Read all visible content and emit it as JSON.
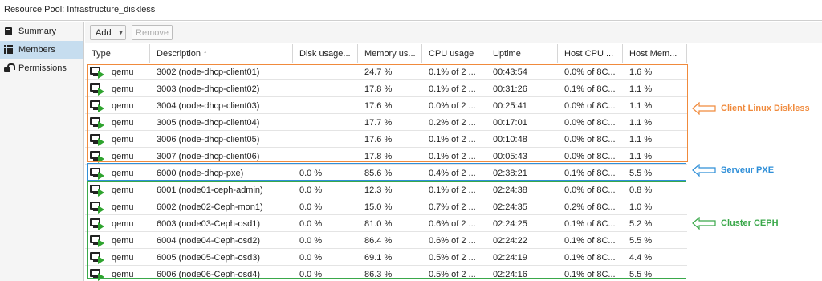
{
  "title": "Resource Pool: Infrastructure_diskless",
  "sidebar": {
    "items": [
      {
        "label": "Summary",
        "icon": "book-icon"
      },
      {
        "label": "Members",
        "icon": "grid-icon",
        "active": true
      },
      {
        "label": "Permissions",
        "icon": "unlock-icon"
      }
    ]
  },
  "toolbar": {
    "add_label": "Add",
    "remove_label": "Remove"
  },
  "table": {
    "columns": [
      "Type",
      "Description",
      "Disk usage...",
      "Memory us...",
      "CPU usage",
      "Uptime",
      "Host CPU ...",
      "Host Mem..."
    ],
    "sort_indicator": "↑",
    "rows": [
      {
        "type": "qemu",
        "description": "3002 (node-dhcp-client01)",
        "disk": "",
        "memory": "24.7 %",
        "cpu": "0.1% of 2 ...",
        "uptime": "00:43:54",
        "host_cpu": "0.0% of 8C...",
        "host_mem": "1.6 %"
      },
      {
        "type": "qemu",
        "description": "3003 (node-dhcp-client02)",
        "disk": "",
        "memory": "17.8 %",
        "cpu": "0.1% of 2 ...",
        "uptime": "00:31:26",
        "host_cpu": "0.1% of 8C...",
        "host_mem": "1.1 %"
      },
      {
        "type": "qemu",
        "description": "3004 (node-dhcp-client03)",
        "disk": "",
        "memory": "17.6 %",
        "cpu": "0.0% of 2 ...",
        "uptime": "00:25:41",
        "host_cpu": "0.0% of 8C...",
        "host_mem": "1.1 %"
      },
      {
        "type": "qemu",
        "description": "3005 (node-dhcp-client04)",
        "disk": "",
        "memory": "17.7 %",
        "cpu": "0.2% of 2 ...",
        "uptime": "00:17:01",
        "host_cpu": "0.0% of 8C...",
        "host_mem": "1.1 %"
      },
      {
        "type": "qemu",
        "description": "3006 (node-dhcp-client05)",
        "disk": "",
        "memory": "17.6 %",
        "cpu": "0.1% of 2 ...",
        "uptime": "00:10:48",
        "host_cpu": "0.0% of 8C...",
        "host_mem": "1.1 %"
      },
      {
        "type": "qemu",
        "description": "3007 (node-dhcp-client06)",
        "disk": "",
        "memory": "17.8 %",
        "cpu": "0.1% of 2 ...",
        "uptime": "00:05:43",
        "host_cpu": "0.0% of 8C...",
        "host_mem": "1.1 %"
      },
      {
        "type": "qemu",
        "description": "6000 (node-dhcp-pxe)",
        "disk": "0.0 %",
        "memory": "85.6 %",
        "cpu": "0.4% of 2 ...",
        "uptime": "02:38:21",
        "host_cpu": "0.1% of 8C...",
        "host_mem": "5.5 %"
      },
      {
        "type": "qemu",
        "description": "6001 (node01-ceph-admin)",
        "disk": "0.0 %",
        "memory": "12.3 %",
        "cpu": "0.1% of 2 ...",
        "uptime": "02:24:38",
        "host_cpu": "0.0% of 8C...",
        "host_mem": "0.8 %"
      },
      {
        "type": "qemu",
        "description": "6002 (node02-Ceph-mon1)",
        "disk": "0.0 %",
        "memory": "15.0 %",
        "cpu": "0.7% of 2 ...",
        "uptime": "02:24:35",
        "host_cpu": "0.2% of 8C...",
        "host_mem": "1.0 %"
      },
      {
        "type": "qemu",
        "description": "6003 (node03-Ceph-osd1)",
        "disk": "0.0 %",
        "memory": "81.0 %",
        "cpu": "0.6% of 2 ...",
        "uptime": "02:24:25",
        "host_cpu": "0.1% of 8C...",
        "host_mem": "5.2 %"
      },
      {
        "type": "qemu",
        "description": "6004 (node04-Ceph-osd2)",
        "disk": "0.0 %",
        "memory": "86.4 %",
        "cpu": "0.6% of 2 ...",
        "uptime": "02:24:22",
        "host_cpu": "0.1% of 8C...",
        "host_mem": "5.5 %"
      },
      {
        "type": "qemu",
        "description": "6005 (node05-Ceph-osd3)",
        "disk": "0.0 %",
        "memory": "69.1 %",
        "cpu": "0.5% of 2 ...",
        "uptime": "02:24:19",
        "host_cpu": "0.1% of 8C...",
        "host_mem": "4.4 %"
      },
      {
        "type": "qemu",
        "description": "6006 (node06-Ceph-osd4)",
        "disk": "0.0 %",
        "memory": "86.3 %",
        "cpu": "0.5% of 2 ...",
        "uptime": "02:24:16",
        "host_cpu": "0.1% of 8C...",
        "host_mem": "5.5 %"
      }
    ]
  },
  "annotations": [
    {
      "label": "Client Linux Diskless",
      "color": "#f08a3c"
    },
    {
      "label": "Serveur PXE",
      "color": "#2f8fd8"
    },
    {
      "label": "Cluster CEPH",
      "color": "#3aa84a"
    }
  ],
  "colors": {
    "selected_nav": "#c6ddef",
    "running_status": "#2ea32e"
  }
}
